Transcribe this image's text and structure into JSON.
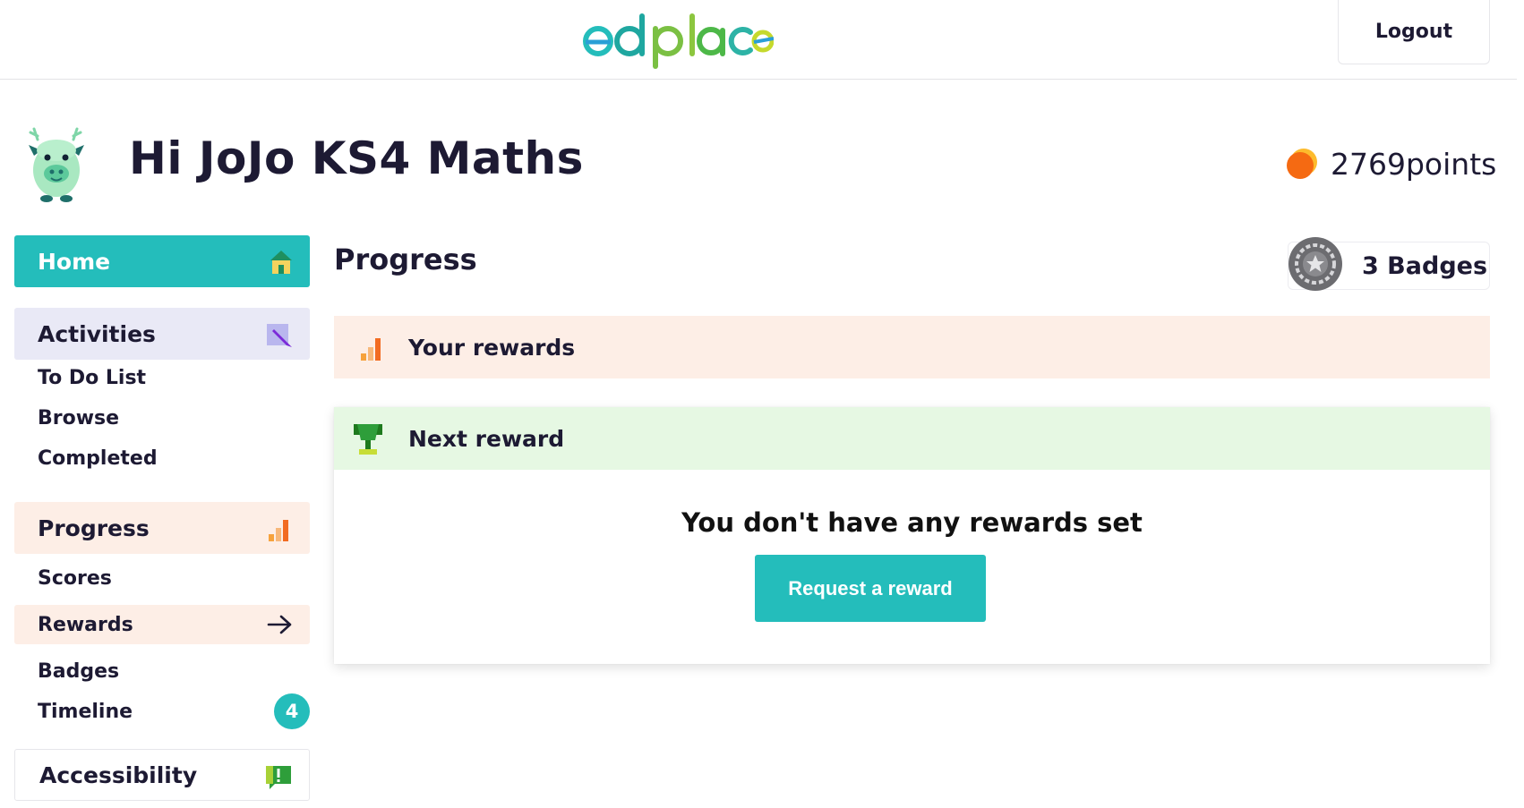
{
  "header": {
    "logo_text": "ed place",
    "logout_label": "Logout"
  },
  "user": {
    "greeting": "Hi JoJo KS4 Maths",
    "points": "2769points"
  },
  "sidebar": {
    "home_label": "Home",
    "activities": {
      "label": "Activities",
      "items": [
        {
          "label": "To Do List"
        },
        {
          "label": "Browse"
        },
        {
          "label": "Completed"
        }
      ]
    },
    "progress": {
      "label": "Progress",
      "items": [
        {
          "label": "Scores"
        },
        {
          "label": "Rewards",
          "active": true
        },
        {
          "label": "Badges"
        },
        {
          "label": "Timeline",
          "count": "4"
        }
      ]
    },
    "accessibility_label": "Accessibility"
  },
  "main": {
    "title": "Progress",
    "badges_label": "3 Badges",
    "your_rewards_label": "Your rewards",
    "next_reward": {
      "label": "Next reward",
      "empty_message": "You don't have any rewards set",
      "button_label": "Request a reward"
    }
  },
  "colors": {
    "accent_teal": "#24bdbb",
    "activities_bg": "#e9e9f6",
    "progress_bg": "#fdeee6",
    "next_reward_bg": "#e6f8e3",
    "text_dark": "#1d1a33"
  },
  "icons": {
    "home": "home-icon",
    "activities": "pencil-icon",
    "progress": "bar-chart-icon",
    "rewards_arrow": "arrow-right-icon",
    "accessibility": "speech-exclamation-icon",
    "coin": "coin-icon",
    "badge": "medal-icon",
    "trophy": "trophy-icon"
  }
}
